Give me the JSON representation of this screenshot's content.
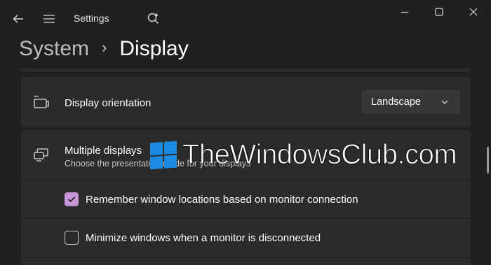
{
  "window": {
    "app_title": "Settings",
    "controls": {
      "back_icon": "arrow-left-icon",
      "menu_icon": "hamburger-icon",
      "search_icon": "search-icon",
      "minimize_icon": "minimize-icon",
      "maximize_icon": "maximize-icon",
      "close_icon": "close-icon"
    }
  },
  "breadcrumb": {
    "parent": "System",
    "separator": "›",
    "current": "Display"
  },
  "settings": {
    "orientation": {
      "title": "Display orientation",
      "icon": "display-orientation-icon",
      "selected": "Landscape"
    },
    "multiple_displays": {
      "title": "Multiple displays",
      "subtitle": "Choose the presentation mode for your displays",
      "icon": "multiple-displays-icon",
      "options": [
        {
          "label": "Remember window locations based on monitor connection",
          "checked": true
        },
        {
          "label": "Minimize windows when a monitor is disconnected",
          "checked": false
        }
      ]
    }
  },
  "watermark": {
    "text": "TheWindowsClub.com"
  },
  "colors": {
    "background": "#202020",
    "card": "#2b2b2b",
    "accent": "#c797d9",
    "watermark_logo": "#1a8be0"
  }
}
